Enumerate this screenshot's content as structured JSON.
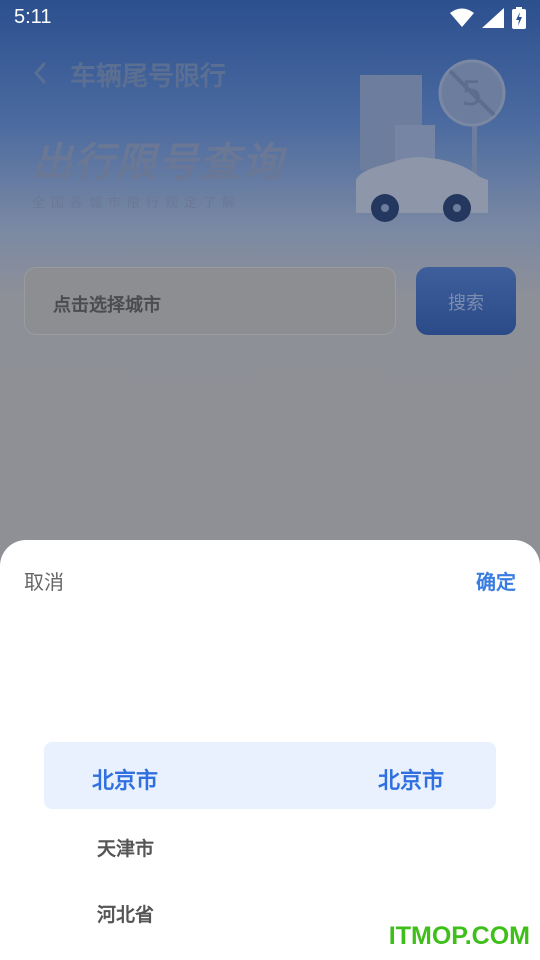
{
  "status_bar": {
    "time": "5:11",
    "icons": [
      "wifi-icon",
      "signal-icon",
      "battery-charging-icon"
    ]
  },
  "header": {
    "title": "车辆尾号限行",
    "back_icon": "chevron-left-icon"
  },
  "banner": {
    "title": "出行限号查询",
    "subtitle": "全国各城市限行规定了解",
    "illustration": "car-with-limit-5-sign",
    "sign_number": "5"
  },
  "search": {
    "placeholder": "点击选择城市",
    "button_label": "搜索"
  },
  "picker": {
    "cancel_label": "取消",
    "confirm_label": "确定",
    "selected": {
      "province": "北京市",
      "city": "北京市"
    },
    "options": [
      "天津市",
      "河北省"
    ]
  },
  "watermark": "ITMOP.COM",
  "colors": {
    "accent": "#3a7de0",
    "highlight": "#e8f1fd",
    "watermark": "#3fbf1a"
  }
}
